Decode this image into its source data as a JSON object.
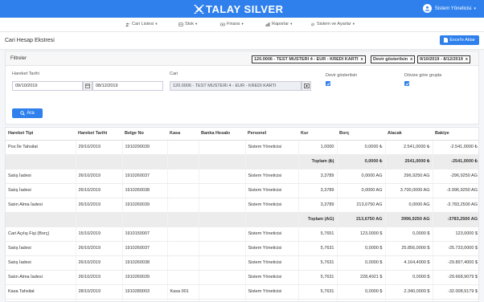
{
  "brand": {
    "name": "TALAY SILVER",
    "accent": "#2f80ed"
  },
  "user": {
    "name": "Sistem Yöneticisi"
  },
  "menu": [
    {
      "label": "Cari Listesi",
      "icon": "users-icon"
    },
    {
      "label": "Stok",
      "icon": "box-icon"
    },
    {
      "label": "Finans",
      "icon": "finance-icon"
    },
    {
      "label": "Raporlar",
      "icon": "chart-icon"
    },
    {
      "label": "Sistem ve Ayarlar",
      "icon": "gear-icon"
    }
  ],
  "page": {
    "title": "Cari Hesap Ekstresi",
    "excel_label": "Excel'e Aktar"
  },
  "filters": {
    "title": "Filtreler",
    "chips": [
      "120.0006 - TEST MUSTERI 4 - EUR - KREDI KARTI",
      "Devir gösterilsin",
      "9/10/2019 - 8/12/2019"
    ],
    "date_label": "Hareket Tarihi",
    "date_from": "09/10/2019",
    "date_to": "08/12/2019",
    "cari_label": "Cari",
    "cari_value": "120.0006 - TEST MUSTERI 4 - EUR - KREDI KARTI",
    "devir_label": "Devir gösterilsin",
    "doviz_label": "Dövize göre grupla",
    "search_label": "Ara"
  },
  "table": {
    "headers": [
      "Hareket Tipi",
      "Hareket Tarihi",
      "Belge No",
      "Kasa",
      "Banka Hesabı",
      "Personel",
      "Kur",
      "Borç",
      "Alacak",
      "Bakiye"
    ],
    "rows": [
      {
        "total": false,
        "cells": [
          "Pos İle Tahsilat",
          "29/10/2019",
          "1910290039",
          "",
          "",
          "Sistem Yöneticisi",
          "1,0000",
          "0,0000 ₺",
          "2.541,0000 ₺",
          "-2.541,0000 ₺"
        ]
      },
      {
        "total": true,
        "cells": [
          "",
          "",
          "",
          "",
          "",
          "",
          "Toplam (₺)",
          "0,0000 ₺",
          "2541,0000 ₺",
          "-2541,0000 ₺"
        ]
      },
      {
        "total": false,
        "cells": [
          "Satış İadesi",
          "26/10/2019",
          "1910260037",
          "",
          "",
          "Sistem Yöneticisi",
          "3,3789",
          "0,0000 AG",
          "296,9250 AG",
          "-296,9250 AG"
        ]
      },
      {
        "total": false,
        "cells": [
          "Satış İadesi",
          "26/10/2019",
          "1910260038",
          "",
          "",
          "Sistem Yöneticisi",
          "3,3789",
          "0,0000 AG",
          "3.700,0000 AG",
          "-3.996,9250 AG"
        ]
      },
      {
        "total": false,
        "cells": [
          "Satın Alma İadesi",
          "26/10/2019",
          "1910260039",
          "",
          "",
          "Sistem Yöneticisi",
          "3,3789",
          "213,6750 AG",
          "0,0000 AG",
          "-3.783,2500 AG"
        ]
      },
      {
        "total": true,
        "cells": [
          "",
          "",
          "",
          "",
          "",
          "",
          "Toplam (AG)",
          "213,6750 AG",
          "3996,9250 AG",
          "-3783,2500 AG"
        ]
      },
      {
        "total": false,
        "cells": [
          "Cari Açılış Fişi (Borç)",
          "15/10/2019",
          "1910150007",
          "",
          "",
          "Sistem Yöneticisi",
          "5,7651",
          "123,0000 $",
          "0,0000 $",
          "123,0000 $"
        ]
      },
      {
        "total": false,
        "cells": [
          "Satış İadesi",
          "26/10/2019",
          "1910260037",
          "",
          "",
          "Sistem Yöneticisi",
          "5,7631",
          "0,0000 $",
          "25.856,0000 $",
          "-25.733,0000 $"
        ]
      },
      {
        "total": false,
        "cells": [
          "Satış İadesi",
          "26/10/2019",
          "1910260038",
          "",
          "",
          "Sistem Yöneticisi",
          "5,7631",
          "0,0000 $",
          "4.164,4000 $",
          "-29.897,4000 $"
        ]
      },
      {
        "total": false,
        "cells": [
          "Satın Alma İadesi",
          "26/10/2019",
          "1910260039",
          "",
          "",
          "Sistem Yöneticisi",
          "5,7631",
          "228,4921 $",
          "0,0000 $",
          "-29.668,9079 $"
        ]
      },
      {
        "total": false,
        "cells": [
          "Kasa Tahsilat",
          "28/10/2019",
          "1910280003",
          "Kasa 001",
          "",
          "Sistem Yöneticisi",
          "5,7631",
          "0,0000 $",
          "2.340,0000 $",
          "-32.008,9179 $"
        ]
      },
      {
        "total": false,
        "cells": [
          "",
          "",
          "",
          "",
          "",
          "",
          "",
          "",
          "",
          ""
        ]
      }
    ]
  }
}
